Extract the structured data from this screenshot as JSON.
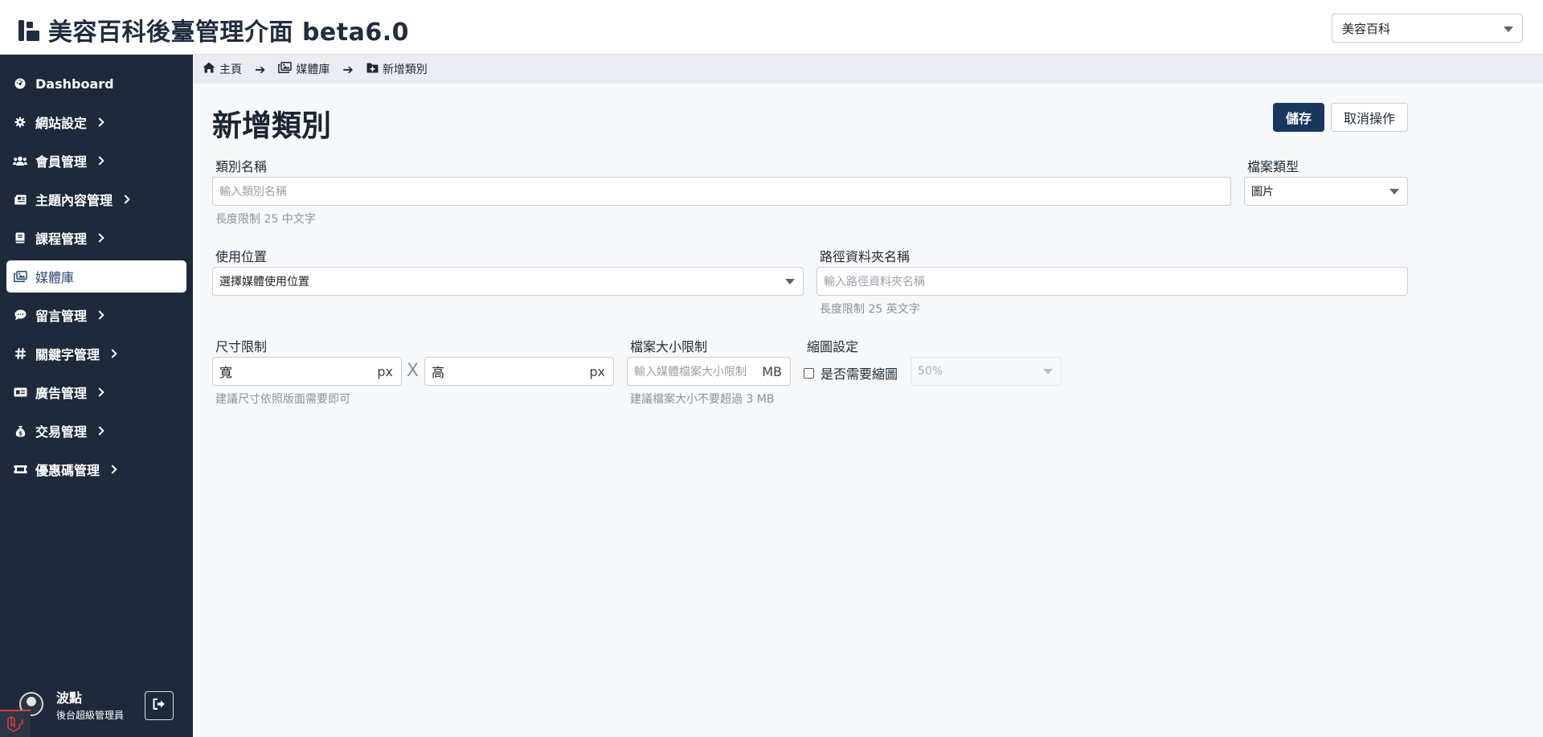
{
  "app": {
    "title": "美容百科後臺管理介面 beta6.0",
    "site_selector_value": "美容百科"
  },
  "sidebar": {
    "items": [
      {
        "label": "Dashboard",
        "icon": "dashboard-gauge-icon",
        "has_children": false,
        "active": false
      },
      {
        "label": "網站設定",
        "icon": "gear-icon",
        "has_children": true,
        "active": false
      },
      {
        "label": "會員管理",
        "icon": "users-icon",
        "has_children": true,
        "active": false
      },
      {
        "label": "主題內容管理",
        "icon": "newspaper-icon",
        "has_children": true,
        "active": false
      },
      {
        "label": "課程管理",
        "icon": "book-icon",
        "has_children": true,
        "active": false
      },
      {
        "label": "媒體庫",
        "icon": "images-icon",
        "has_children": false,
        "active": true
      },
      {
        "label": "留言管理",
        "icon": "comment-icon",
        "has_children": true,
        "active": false
      },
      {
        "label": "關鍵字管理",
        "icon": "hashtag-icon",
        "has_children": true,
        "active": false
      },
      {
        "label": "廣告管理",
        "icon": "ad-icon",
        "has_children": true,
        "active": false
      },
      {
        "label": "交易管理",
        "icon": "money-bag-icon",
        "has_children": true,
        "active": false
      },
      {
        "label": "優惠碼管理",
        "icon": "ticket-icon",
        "has_children": true,
        "active": false
      }
    ],
    "user": {
      "name": "波點",
      "role": "後台超級管理員"
    }
  },
  "breadcrumb": {
    "home": "主頁",
    "media": "媒體庫",
    "current": "新增類別"
  },
  "page": {
    "title": "新增類別",
    "save_label": "儲存",
    "cancel_label": "取消操作"
  },
  "form": {
    "category_name": {
      "label": "類別名稱",
      "placeholder": "輸入類別名稱",
      "help": "長度限制 25 中文字"
    },
    "file_type": {
      "label": "檔案類型",
      "value": "圖片"
    },
    "usage_location": {
      "label": "使用位置",
      "value": "選擇媒體使用位置"
    },
    "folder_name": {
      "label": "路徑資料夾名稱",
      "placeholder": "輸入路徑資料夾名稱",
      "help": "長度限制 25 英文字"
    },
    "size_limit": {
      "label": "尺寸限制",
      "width_value": "寬",
      "height_value": "高",
      "unit": "px",
      "separator": "X",
      "help": "建議尺寸依照版面需要即可"
    },
    "file_size_limit": {
      "label": "檔案大小限制",
      "placeholder": "輸入媒體檔案大小限制",
      "unit": "MB",
      "help": "建議檔案大小不要超過 3 MB"
    },
    "thumbnail": {
      "label": "縮圖設定",
      "checkbox_label": "是否需要縮圖",
      "checked": false,
      "ratio_value": "50%"
    }
  }
}
